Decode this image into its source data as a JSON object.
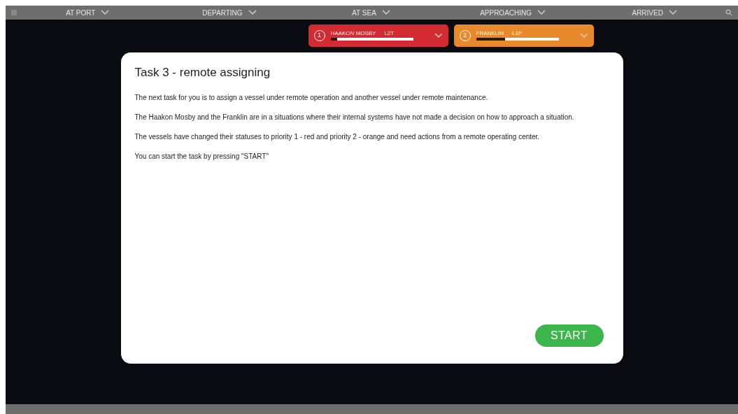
{
  "nav": {
    "items": [
      {
        "label": "AT PORT",
        "selected": false
      },
      {
        "label": "DEPARTING",
        "selected": false
      },
      {
        "label": "AT SEA",
        "selected": false
      },
      {
        "label": "APPROACHING",
        "selected": false
      },
      {
        "label": "ARRIVED",
        "selected": false
      }
    ]
  },
  "vessels": [
    {
      "priority": "1",
      "name": "HAAKON MOSBY",
      "code": "L2T",
      "color": "#d42a32",
      "level": 0.92
    },
    {
      "priority": "2",
      "name": "FRANKLIN",
      "code": "L1P",
      "color": "#e88a2c",
      "level": 0.65
    }
  ],
  "dialog": {
    "title": "Task 3 - remote assigning",
    "paragraphs": [
      "The next task for you is to assign a vessel under remote operation and another vessel under remote maintenance.",
      "The Haakon Mosby and the Franklin are in a situations where their internal systems have not made a decision on how to approach a situation.",
      "The vessels have changed their statuses to priority 1 - red and  priority 2 - orange and need actions from a remote operating center.",
      "You can start the task by pressing \"START\""
    ],
    "button": "START"
  }
}
